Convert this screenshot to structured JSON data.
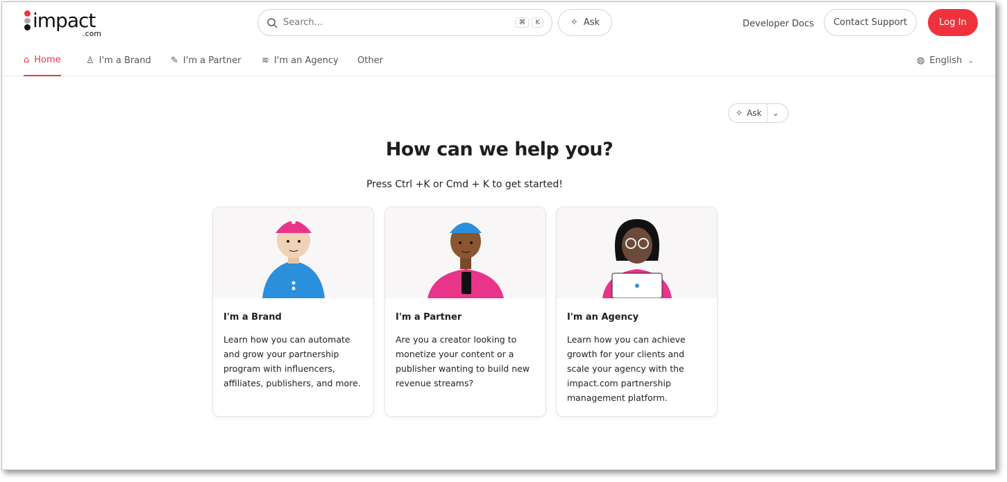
{
  "header": {
    "logo_text": "impact",
    "logo_suffix": ".com",
    "search_placeholder": "Search...",
    "kbd_cmd": "⌘",
    "kbd_k": "K",
    "ask_label": "Ask",
    "developer_docs": "Developer Docs",
    "contact_support": "Contact Support",
    "login": "Log In"
  },
  "nav": {
    "tabs": [
      {
        "label": "Home",
        "icon": "home-icon"
      },
      {
        "label": "I'm a Brand",
        "icon": "user-icon"
      },
      {
        "label": "I'm a Partner",
        "icon": "partner-icon"
      },
      {
        "label": "I'm an Agency",
        "icon": "handshake-icon"
      },
      {
        "label": "Other"
      }
    ],
    "language": "English"
  },
  "main": {
    "ask_label": "Ask",
    "title": "How can we help you?",
    "subtitle": "Press Ctrl +K or Cmd + K to get started!",
    "cards": [
      {
        "title": "I'm a Brand",
        "text": "Learn how you can automate and grow your partnership program with influencers, affiliates, publishers, and more."
      },
      {
        "title": "I'm a Partner",
        "text": "Are you a creator looking to monetize your content or a publisher wanting to build new revenue streams?"
      },
      {
        "title": "I'm an Agency",
        "text": "Learn how you can achieve growth for your clients and scale your agency with the impact.com partnership management platform."
      }
    ]
  },
  "colors": {
    "accent": "#f0323c",
    "pink": "#e8348a",
    "blue": "#2b8fdc"
  }
}
